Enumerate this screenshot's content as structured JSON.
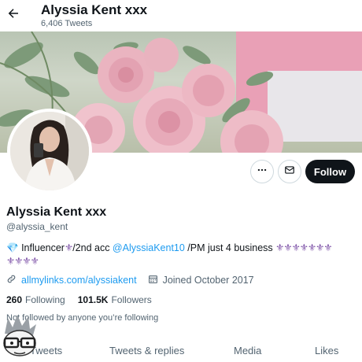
{
  "header": {
    "name": "Alyssia Kent xxx",
    "tweet_count": "6,406 Tweets",
    "back_icon": "arrow-left-icon"
  },
  "profile": {
    "display_name": "Alyssia Kent xxx",
    "handle": "@alyssia_kent",
    "bio": {
      "gem": "💎",
      "text1": "Influencer",
      "fleur1": "⚜",
      "text2": "/2nd acc ",
      "mention": "@AlyssiaKent10",
      "text3": " /PM just 4 business ",
      "fleurs_line1": "⚜⚜⚜⚜⚜⚜⚜",
      "fleurs_line2": "⚜⚜⚜⚜"
    },
    "website": "allmylinks.com/alyssiakent",
    "joined": "Joined October 2017",
    "following_count": "260",
    "following_label": "Following",
    "followers_count": "101.5K",
    "followers_label": "Followers",
    "not_followed_text": "Not followed by anyone you’re following"
  },
  "actions": {
    "more_icon": "more-icon",
    "message_icon": "mail-icon",
    "follow_label": "Follow"
  },
  "tabs": [
    {
      "label": "Tweets"
    },
    {
      "label": "Tweets & replies"
    },
    {
      "label": "Media"
    },
    {
      "label": "Likes"
    }
  ],
  "colors": {
    "accent": "#1d9bf0",
    "text": "#0f1419",
    "muted": "#536471",
    "follow_bg": "#0f1419"
  }
}
